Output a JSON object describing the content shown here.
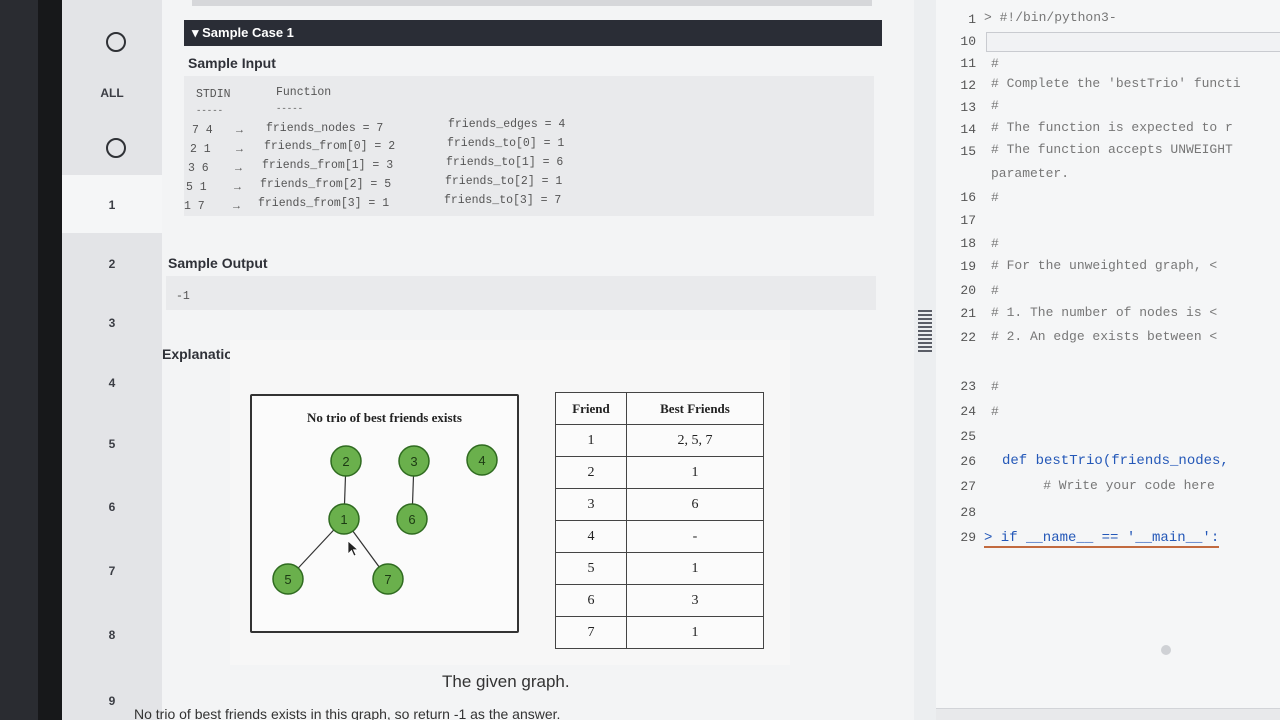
{
  "nav": {
    "all_label": "ALL",
    "numbers": [
      "1",
      "2",
      "3",
      "4",
      "5",
      "6",
      "7",
      "8",
      "9"
    ]
  },
  "problem": {
    "case_title": "▾ Sample Case 1",
    "sample_input_title": "Sample Input",
    "col_stdin": "STDIN",
    "col_function": "Function",
    "dashes1": "-----",
    "dashes2": "-----",
    "input_rows": [
      {
        "stdin": "7 4",
        "arrow": "→",
        "func": "friends_nodes = 7",
        "func2": "friends_edges = 4"
      },
      {
        "stdin": "2 1",
        "arrow": "→",
        "func": "friends_from[0] = 2",
        "func2": "friends_to[0] = 1"
      },
      {
        "stdin": "3 6",
        "arrow": "→",
        "func": "friends_from[1] = 3",
        "func2": "friends_to[1] = 6"
      },
      {
        "stdin": "5 1",
        "arrow": "→",
        "func": "friends_from[2] = 5",
        "func2": "friends_to[2] = 1"
      },
      {
        "stdin": "1 7",
        "arrow": "→",
        "func": "friends_from[3] = 1",
        "func2": "friends_to[3] = 7"
      }
    ],
    "sample_output_title": "Sample Output",
    "output_value": "-1",
    "explanation_title": "Explanation",
    "graph_title": "No trio of best friends exists",
    "graph_nodes": [
      "2",
      "3",
      "4",
      "1",
      "6",
      "5",
      "7"
    ],
    "table_headers": [
      "Friend",
      "Best Friends"
    ],
    "table_rows": [
      [
        "1",
        "2, 5, 7"
      ],
      [
        "2",
        "1"
      ],
      [
        "3",
        "6"
      ],
      [
        "4",
        "-"
      ],
      [
        "5",
        "1"
      ],
      [
        "6",
        "3"
      ],
      [
        "7",
        "1"
      ]
    ],
    "caption": "The given graph.",
    "bottom_text": "No trio of best friends exists in this graph, so return -1 as the answer."
  },
  "editor": {
    "lines": [
      {
        "n": "1",
        "t": "> #!/bin/python3-"
      },
      {
        "n": "10",
        "t": ""
      },
      {
        "n": "11",
        "t": "#"
      },
      {
        "n": "12",
        "t": "# Complete the 'bestTrio' functi"
      },
      {
        "n": "13",
        "t": "#"
      },
      {
        "n": "14",
        "t": "# The function is expected to r"
      },
      {
        "n": "15",
        "t": "# The function accepts UNWEIGHT"
      },
      {
        "n": "",
        "t": "parameter."
      },
      {
        "n": "16",
        "t": "#"
      },
      {
        "n": "17",
        "t": ""
      },
      {
        "n": "18",
        "t": "#"
      },
      {
        "n": "19",
        "t": "# For the unweighted graph, <"
      },
      {
        "n": "20",
        "t": "#"
      },
      {
        "n": "21",
        "t": "# 1. The number of nodes is <"
      },
      {
        "n": "22",
        "t": "# 2. An edge exists between <"
      },
      {
        "n": "23",
        "t": "#"
      },
      {
        "n": "24",
        "t": "#"
      },
      {
        "n": "25",
        "t": ""
      },
      {
        "n": "26",
        "t": "def bestTrio(friends_nodes,"
      },
      {
        "n": "27",
        "t": "    # Write your code here"
      },
      {
        "n": "28",
        "t": ""
      },
      {
        "n": "29",
        "t": "> if __name__ == '__main__':"
      }
    ]
  },
  "colors": {
    "node_fill": "#6ab04c",
    "node_stroke": "#2f6b20",
    "header_bar": "#2a2d36"
  }
}
